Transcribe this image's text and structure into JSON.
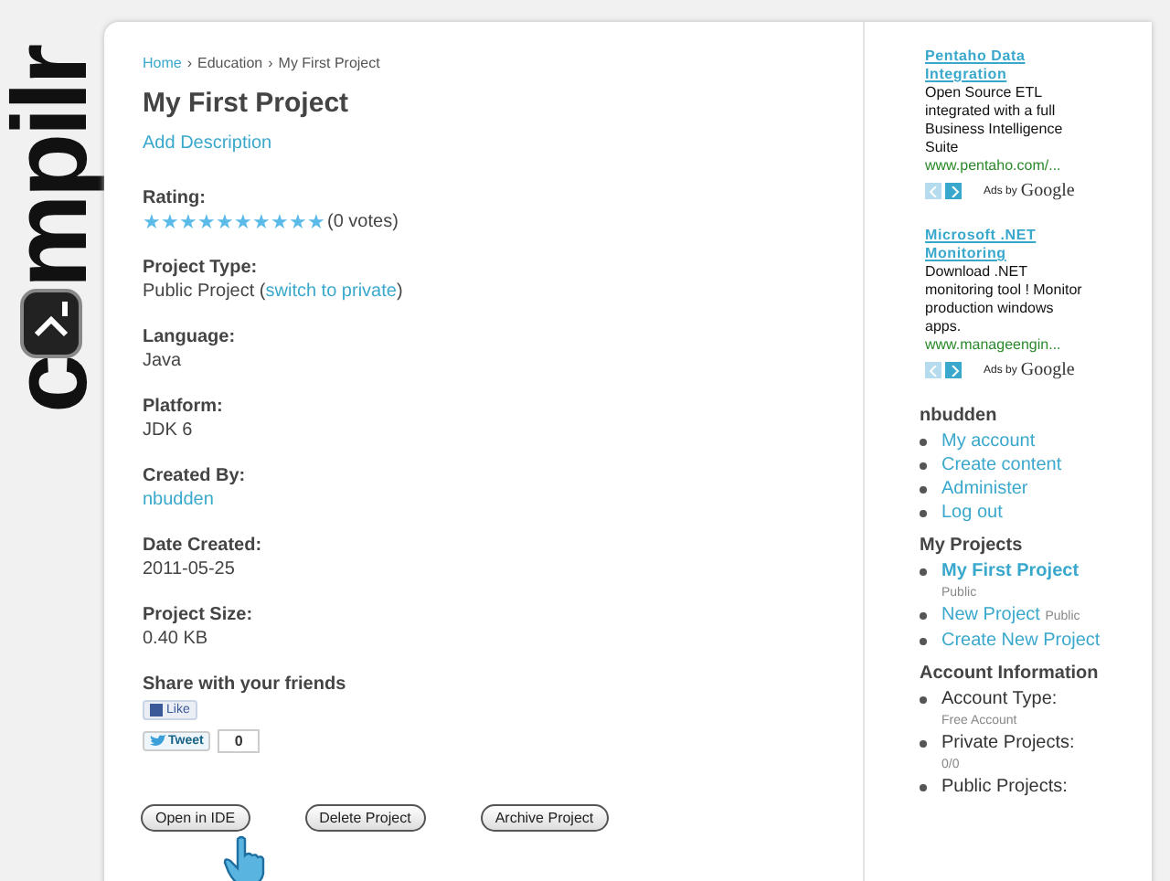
{
  "logo": {
    "parts": [
      "c",
      "mpilr"
    ]
  },
  "breadcrumb": [
    {
      "label": "Home",
      "link": true
    },
    {
      "label": "Education",
      "link": false
    },
    {
      "label": "My First Project",
      "link": false
    }
  ],
  "breadcrumb_separator": "›",
  "title": "My First Project",
  "add_description": "Add Description",
  "rating": {
    "label": "Rating:",
    "stars": 10,
    "votes": "(0 votes)"
  },
  "fields": [
    {
      "label": "Project Type:",
      "value": "Public Project (",
      "link": "switch to private",
      "after": ")"
    },
    {
      "label": "Language:",
      "value": "Java"
    },
    {
      "label": "Platform:",
      "value": "JDK 6"
    },
    {
      "label": "Created By:",
      "link": "nbudden"
    },
    {
      "label": "Date Created:",
      "value": "2011-05-25"
    },
    {
      "label": "Project Size:",
      "value": "0.40 KB"
    }
  ],
  "share": {
    "label": "Share with your friends",
    "like": "Like",
    "tweet": "Tweet",
    "tweet_count": "0"
  },
  "buttons": [
    "Open in IDE",
    "Delete Project",
    "Archive Project"
  ],
  "ads": [
    {
      "title": "Pentaho Data Integration",
      "text": "Open Source ETL integrated with a full Business Intelligence Suite",
      "url": "www.pentaho.com/...",
      "ads_by": "Ads by",
      "brand": "Google"
    },
    {
      "title": "Microsoft .NET Monitoring",
      "text": "Download .NET monitoring tool ! Monitor production windows apps.",
      "url": "www.manageengin...",
      "ads_by": "Ads by",
      "brand": "Google"
    }
  ],
  "user_menu": {
    "title": "nbudden",
    "items": [
      "My account",
      "Create content",
      "Administer",
      "Log out"
    ]
  },
  "projects": {
    "title": "My Projects",
    "items": [
      {
        "label": "My First Project",
        "tag": "Public",
        "selected": true
      },
      {
        "label": "New Project",
        "tag": "Public",
        "selected": false
      },
      {
        "label": "Create New Project",
        "selected": false
      }
    ]
  },
  "account": {
    "title": "Account Information",
    "items": [
      {
        "label": "Account Type:",
        "value": "Free Account"
      },
      {
        "label": "Private Projects:",
        "value": "0/0"
      },
      {
        "label": "Public Projects:"
      }
    ]
  }
}
